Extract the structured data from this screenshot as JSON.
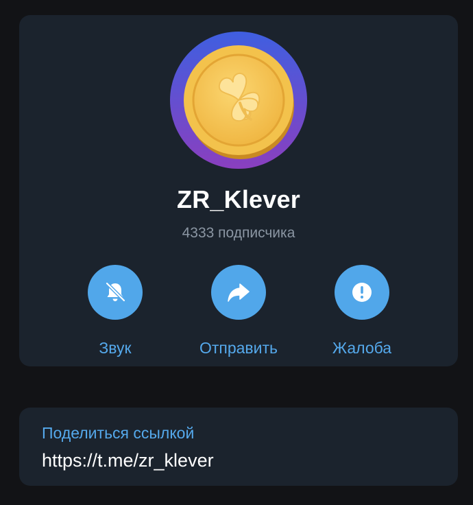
{
  "channel": {
    "name": "ZR_Klever",
    "subscribers": "4333 подписчика"
  },
  "actions": [
    {
      "label": "Звук",
      "icon": "bell-muted-icon"
    },
    {
      "label": "Отправить",
      "icon": "share-arrow-icon"
    },
    {
      "label": "Жалоба",
      "icon": "exclamation-icon"
    }
  ],
  "share": {
    "title": "Поделиться ссылкой",
    "url": "https://t.me/zr_klever"
  },
  "colors": {
    "background": "#121316",
    "card": "#1b232d",
    "accent": "#51a7ea",
    "accent_text": "#55a9ec",
    "muted_text": "#8b96a3",
    "avatar_ring_top": "#3f5fe0",
    "avatar_ring_bottom": "#8a3fbf",
    "coin": "#f5c04a"
  }
}
